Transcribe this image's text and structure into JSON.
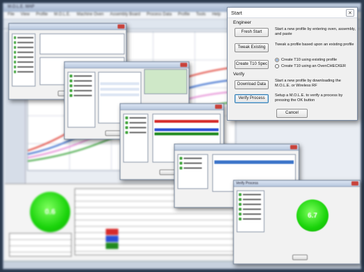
{
  "background_app": {
    "title": "M.O.L.E. MAP",
    "menu": [
      "File",
      "View",
      "Profile",
      "M.O.L.E.",
      "Machine Oven",
      "Assembly Board",
      "Process Data",
      "Profile",
      "Tools",
      "Help"
    ],
    "score_value": "0.6"
  },
  "start_dialog": {
    "title": "Start",
    "close_label": "×",
    "engineer": {
      "label": "Engineer",
      "fresh_start": {
        "label": "Fresh Start",
        "desc": "Start a new profile by entering oven, assembly, and paste"
      },
      "tweak_existing": {
        "label": "Tweak Existing",
        "desc": "Tweak a profile based upon an existing profile"
      },
      "create_t10": {
        "label": "Create T10 Spec"
      },
      "radio_existing": "Create T10 using existing profile",
      "radio_ovencheck": "Create T10 using an OvenCHECKER"
    },
    "verify": {
      "label": "Verify",
      "download_data": {
        "label": "Download Data",
        "desc": "Start a new profile by downloading the M.O.L.E. or Wireless RF"
      },
      "verify_process": {
        "label": "Verify Process",
        "desc": "Setup a M.O.L.E. to verify a process by pressing the OK button"
      }
    },
    "cancel_label": "Cancel"
  },
  "verify_window": {
    "title": "Verify Process",
    "score_value": "6.7"
  },
  "colors": {
    "green_score": "#19d30a",
    "dialog_bg": "#f0f0f0",
    "accent_blue": "#3c7fb1"
  }
}
